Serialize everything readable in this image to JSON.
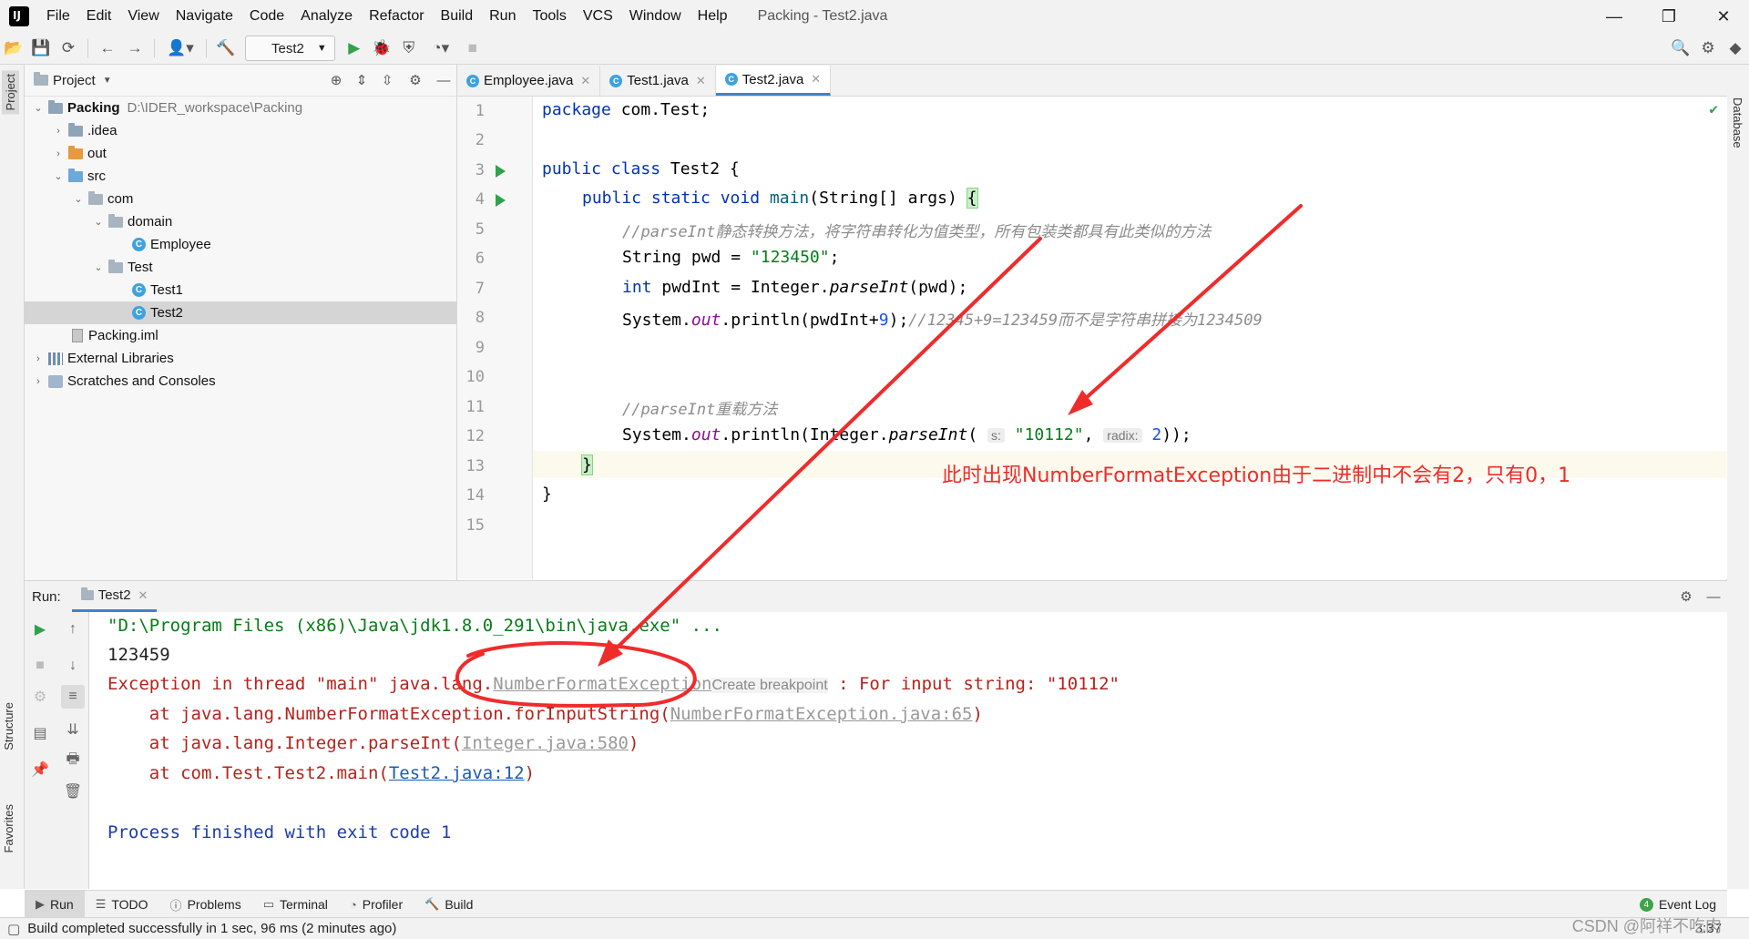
{
  "menu": {
    "items": [
      "File",
      "Edit",
      "View",
      "Navigate",
      "Code",
      "Analyze",
      "Refactor",
      "Build",
      "Run",
      "Tools",
      "VCS",
      "Window",
      "Help"
    ]
  },
  "window": {
    "title": "Packing - Test2.java"
  },
  "toolbar": {
    "run_config": "Test2"
  },
  "stripe": {
    "left_project": "Project",
    "left_structure": "Structure",
    "left_favorites": "Favorites",
    "right_database": "Database"
  },
  "project": {
    "header": "Project",
    "tree": [
      {
        "label": "Packing",
        "hint": "D:\\IDER_workspace\\Packing"
      },
      {
        "label": ".idea"
      },
      {
        "label": "out"
      },
      {
        "label": "src"
      },
      {
        "label": "com"
      },
      {
        "label": "domain"
      },
      {
        "label": "Employee"
      },
      {
        "label": "Test"
      },
      {
        "label": "Test1"
      },
      {
        "label": "Test2"
      },
      {
        "label": "Packing.iml"
      },
      {
        "label": "External Libraries"
      },
      {
        "label": "Scratches and Consoles"
      }
    ]
  },
  "editor": {
    "tabs": [
      "Employee.java",
      "Test1.java",
      "Test2.java"
    ],
    "line_numbers": [
      "1",
      "2",
      "3",
      "4",
      "5",
      "6",
      "7",
      "8",
      "9",
      "10",
      "11",
      "12",
      "13",
      "14",
      "15"
    ],
    "lines": {
      "l1_kw": "package",
      "l1_rest": " com.Test;",
      "l3_kw": "public class",
      "l3_rest": " Test2 {",
      "l4_kw": "public static void",
      "l4_m": " main",
      "l4_rest": "(String[] args) ",
      "l4_brace": "{",
      "l5": "//parseInt静态转换方法，将字符串转化为值类型，所有包装类都具有此类似的方法",
      "l6_a": "String pwd = ",
      "l6_str": "\"123450\"",
      "l6_b": ";",
      "l7_kw": "int",
      "l7_a": " pwdInt = Integer.",
      "l7_m": "parseInt",
      "l7_b": "(pwd);",
      "l8_a": "System.",
      "l8_f": "out",
      "l8_b": ".println(pwdInt+",
      "l8_n": "9",
      "l8_c": ");",
      "l8_cmt": "//12345+9=123459而不是字符串拼接为1234509",
      "l11": "//parseInt重载方法",
      "l12_a": "System.",
      "l12_f": "out",
      "l12_b": ".println(Integer.",
      "l12_m": "parseInt",
      "l12_c": "(",
      "l12_h1": "s:",
      "l12_str": "\"10112\"",
      "l12_d": ", ",
      "l12_h2": "radix:",
      "l12_n": "2",
      "l12_e": "));",
      "l13": "}",
      "l14": "}"
    },
    "annotation": "此时出现NumberFormatException由于二进制中不会有2，只有0，1"
  },
  "run": {
    "label": "Run:",
    "tab": "Test2",
    "console": {
      "line1": "\"D:\\Program Files (x86)\\Java\\jdk1.8.0_291\\bin\\java.exe\" ...",
      "line2": "123459",
      "line3_a": "Exception in thread \"main\" java.lang.",
      "line3_link": "NumberFormatException",
      "line3_tip": "Create breakpoint",
      "line3_b": " : For input string: \"10112\"",
      "line4_a": "    at java.lang.NumberFormatException.forInputString(",
      "line4_link": "NumberFormatException.java:65",
      "line4_b": ")",
      "line5_a": "    at java.lang.Integer.parseInt(",
      "line5_link": "Integer.java:580",
      "line5_b": ")",
      "line6_a": "    at com.Test.Test2.main(",
      "line6_link": "Test2.java:12",
      "line6_b": ")",
      "line8": "Process finished with exit code 1"
    }
  },
  "bottom_tabs": [
    "Run",
    "TODO",
    "Problems",
    "Terminal",
    "Profiler",
    "Build"
  ],
  "event_log": "Event Log",
  "event_count": "4",
  "status": {
    "message": "Build completed successfully in 1 sec, 96 ms (2 minutes ago)",
    "position": "3:37"
  },
  "watermark": "CSDN @阿祥不吃肉",
  "colors": {
    "annotation": "#f02b2b",
    "accent": "#4083c9",
    "run_green": "#2fa34a"
  }
}
